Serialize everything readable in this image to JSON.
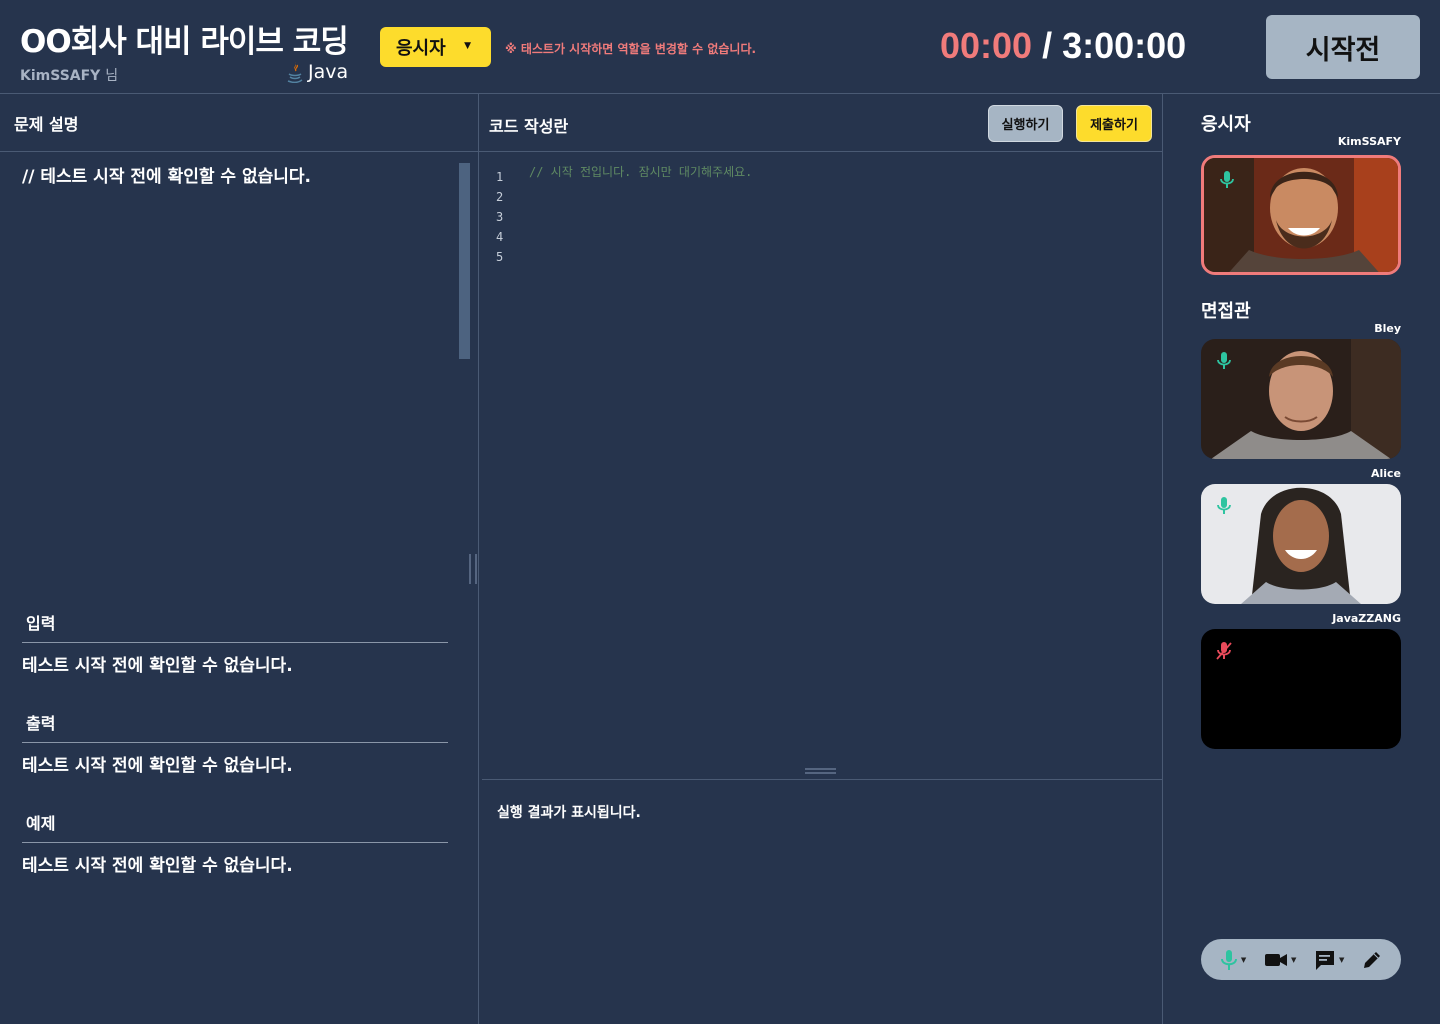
{
  "header": {
    "title": "OO회사 대비 라이브 코딩",
    "username": "KimSSAFY",
    "username_suffix": "님",
    "language": "Java",
    "role_select": {
      "selected": "응시자"
    },
    "warning": "※ 태스트가 시작하면 역할을 변경할 수 없습니다.",
    "timer": {
      "elapsed": "00:00",
      "separator": " / ",
      "total": "3:00:00"
    },
    "start_button": "시작전"
  },
  "problem": {
    "header": "문제 설명",
    "description": "// 테스트 시작 전에 확인할 수 없습니다.",
    "sections": [
      {
        "title": "입력",
        "body": "테스트 시작 전에 확인할 수 없습니다."
      },
      {
        "title": "출력",
        "body": "테스트 시작 전에 확인할 수 없습니다."
      },
      {
        "title": "예제",
        "body": "테스트 시작 전에 확인할 수 없습니다."
      }
    ]
  },
  "editor": {
    "header": "코드 작성란",
    "run_button": "실행하기",
    "submit_button": "제출하기",
    "line_numbers": [
      "1",
      "2",
      "3",
      "4",
      "5"
    ],
    "placeholder_code": "// 시작 전입니다. 잠시만 대기해주세요.",
    "output_text": "실행 결과가 표시됩니다."
  },
  "participants": {
    "candidate_title": "응시자",
    "interviewer_title": "면접관",
    "candidate": {
      "name": "KimSSAFY",
      "mic": "on",
      "mic-icon": "mic-icon"
    },
    "interviewers": [
      {
        "name": "Bley",
        "mic": "on"
      },
      {
        "name": "Alice",
        "mic": "on"
      },
      {
        "name": "JavaZZANG",
        "mic": "off"
      }
    ]
  },
  "controls": {
    "items": [
      "mic-icon",
      "video-camera-icon",
      "chat-icon",
      "pencil-icon"
    ]
  },
  "colors": {
    "background": "#26344d",
    "accent_yellow": "#fddc2c",
    "accent_red": "#f07b7b",
    "button_gray": "#a6b5c4",
    "mic_on": "#2ec4a0",
    "mic_off": "#e84a5a",
    "candidate_border": "#f07b7b"
  }
}
